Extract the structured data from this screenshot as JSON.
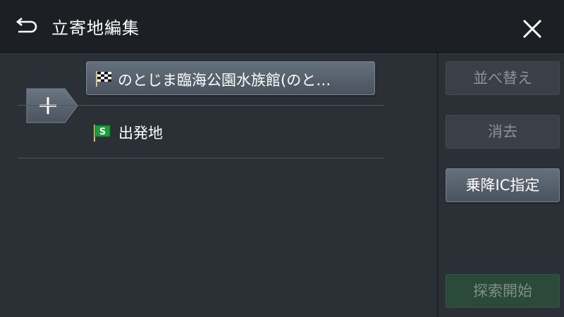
{
  "header": {
    "title": "立寄地編集"
  },
  "route": {
    "destination_label": "のとじま臨海公園水族館(のと…",
    "start_label": "出発地",
    "start_flag_letter": "S"
  },
  "side": {
    "reorder_label": "並べ替え",
    "delete_label": "消去",
    "ic_label": "乗降IC指定",
    "search_start_label": "探索開始"
  },
  "colors": {
    "background": "#2b2f36",
    "header_background": "#1c1f24",
    "active_button": "#5a6470",
    "go_button": "#2c4a3a",
    "start_flag": "#1a9e3a"
  }
}
